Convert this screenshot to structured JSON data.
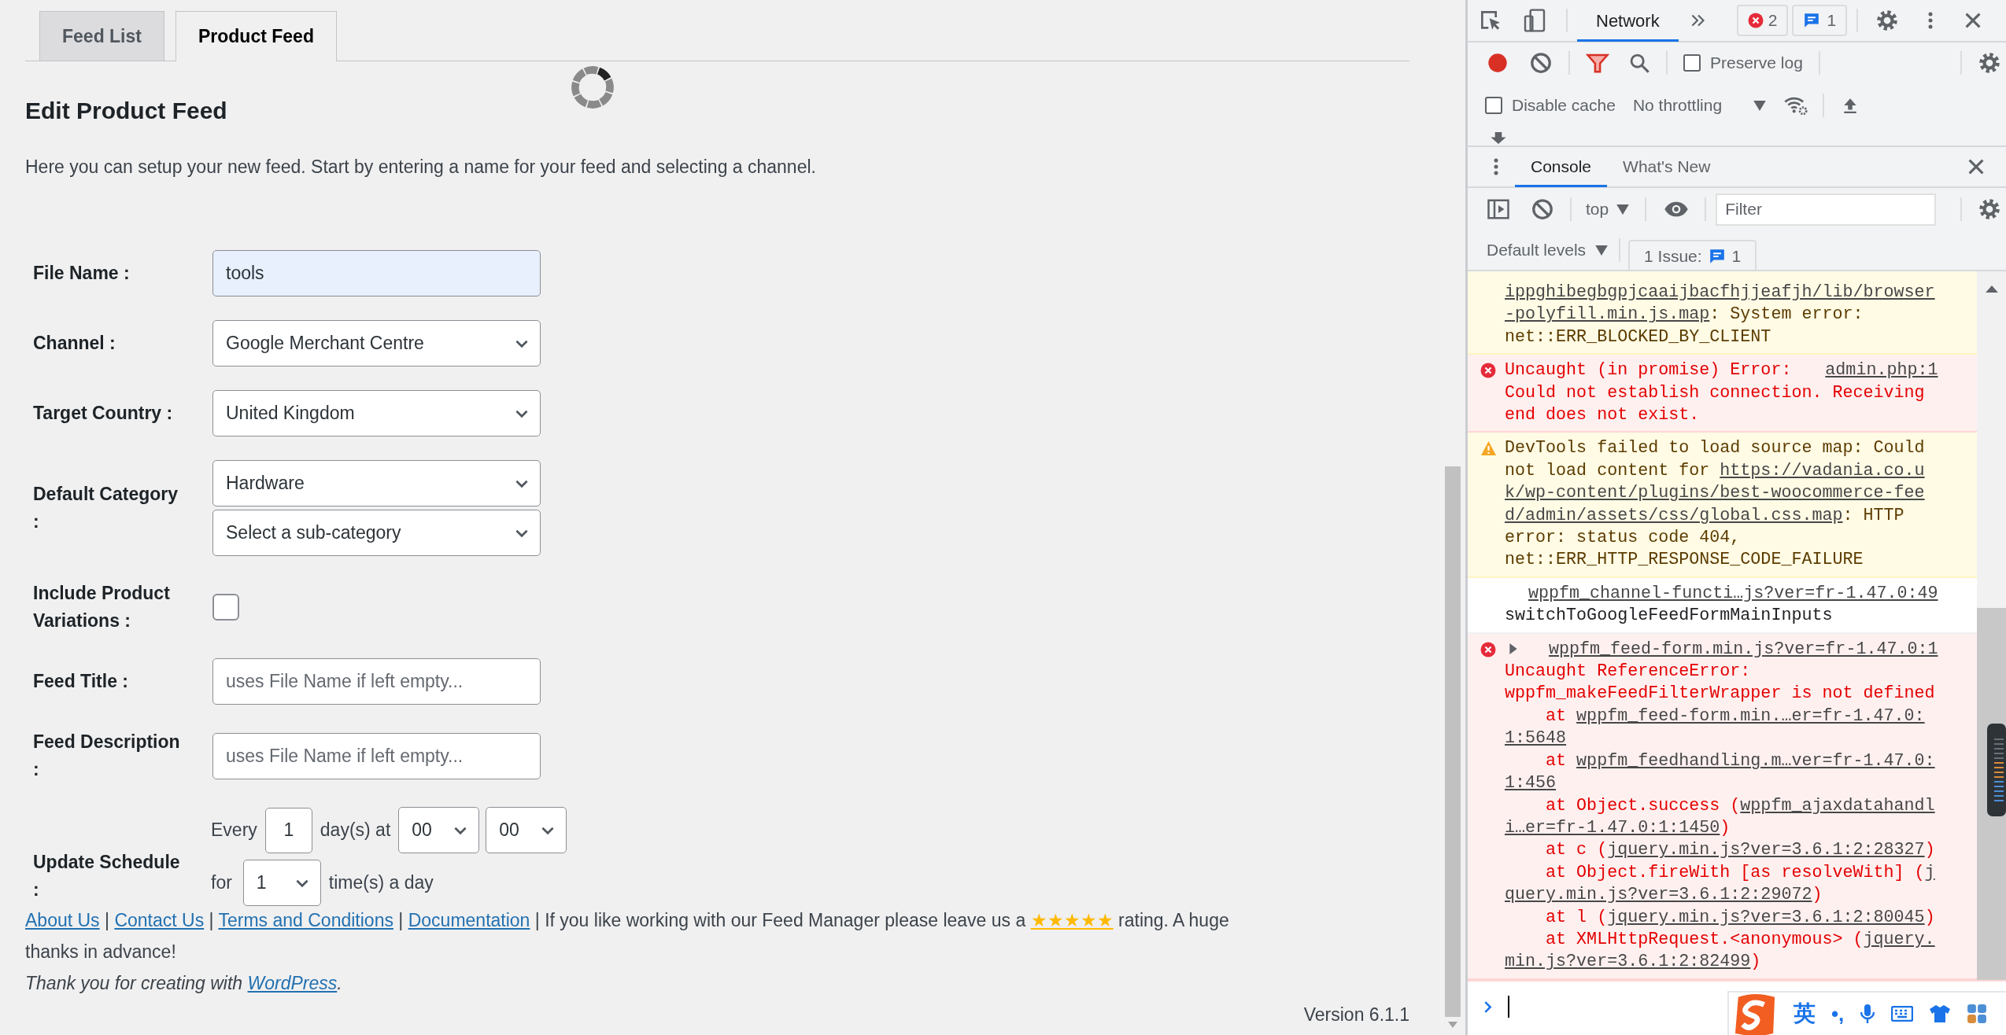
{
  "page_tabs": [
    {
      "label": "Feed List",
      "selected": false
    },
    {
      "label": "Product Feed",
      "selected": true
    }
  ],
  "loading": true,
  "heading": "Edit Product Feed",
  "intro": "Here you can setup your new feed. Start by entering a name for your feed and selecting a channel.",
  "fields": [
    {
      "kind": "text",
      "label": "File Name :",
      "value": "tools",
      "autofilled": true
    },
    {
      "kind": "select",
      "label": "Channel :",
      "values": [
        "Google Merchant Centre"
      ]
    },
    {
      "kind": "select",
      "label": "Target Country :",
      "values": [
        "United Kingdom"
      ]
    },
    {
      "kind": "select",
      "label": "Default Category :",
      "values": [
        "Hardware",
        "Select a sub-category"
      ]
    },
    {
      "kind": "checkbox",
      "label": "Include Product Variations :",
      "checked": false
    },
    {
      "kind": "text",
      "label": "Feed Title :",
      "placeholder": "uses File Name if left empty...",
      "autofilled": false
    },
    {
      "kind": "text",
      "label": "Feed Description :",
      "placeholder": "uses File Name if left empty...",
      "autofilled": false
    },
    {
      "kind": "schedule",
      "label": "Update Schedule :",
      "every_label": "Every",
      "days": "1",
      "days_label": "day(s) at",
      "hour": "00",
      "minute": "00",
      "for_label": "for",
      "times": "1",
      "times_label": "time(s) a day"
    }
  ],
  "footer": [
    {
      "kind": "link",
      "text": "About Us"
    },
    {
      "kind": "text",
      "text": " | "
    },
    {
      "kind": "link",
      "text": "Contact Us"
    },
    {
      "kind": "text",
      "text": " | "
    },
    {
      "kind": "link",
      "text": "Terms and Conditions"
    },
    {
      "kind": "text",
      "text": " | "
    },
    {
      "kind": "link",
      "text": "Documentation"
    },
    {
      "kind": "text",
      "text": " | If you like working with our Feed Manager please leave us a "
    },
    {
      "kind": "stars",
      "text": "★★★★★"
    },
    {
      "kind": "text",
      "text": " rating. A huge thanks in advance!"
    }
  ],
  "credit": [
    {
      "kind": "text",
      "text": "Thank you for creating with "
    },
    {
      "kind": "link",
      "text": "WordPress"
    },
    {
      "kind": "text",
      "text": "."
    }
  ],
  "version": "Version 6.1.1",
  "devtools": {
    "panel_tabs": [
      {
        "label": "Network",
        "selected": true
      }
    ],
    "error_count": "2",
    "message_count": "1",
    "recording": true,
    "preserve_log": {
      "label": "Preserve log",
      "checked": false
    },
    "disable_cache": {
      "label": "Disable cache",
      "checked": false
    },
    "throttling": "No throttling",
    "drawer_tabs": [
      {
        "label": "Console",
        "selected": true
      },
      {
        "label": "What's New",
        "selected": false
      }
    ],
    "context": "top",
    "filter_placeholder": "Filter",
    "levels": "Default levels",
    "issues_label": "1 Issue:",
    "issues_count": "1",
    "messages": [
      {
        "kind": "warning",
        "show_icon": false,
        "parts": [
          {
            "kind": "link",
            "text": "ippghibegbgpjcaaijbacfhjjeafjh/lib/browser"
          },
          {
            "kind": "link",
            "text": "-polyfill.min.js.map"
          },
          {
            "kind": "text",
            "text": ": System error: net::ERR_BLOCKED_BY_CLIENT"
          }
        ]
      },
      {
        "kind": "error",
        "show_icon": true,
        "parts": [
          {
            "kind": "text",
            "text": "Uncaught (in promise) Error: "
          },
          {
            "kind": "source",
            "text": "admin.php:1"
          },
          {
            "kind": "text",
            "text": "Could not establish connection. Receiving end does not exist."
          }
        ]
      },
      {
        "kind": "warning",
        "show_icon": true,
        "parts": [
          {
            "kind": "text",
            "text": "DevTools failed to load source map: Could not load content for "
          },
          {
            "kind": "link",
            "text": "https://vadania.co.u"
          },
          {
            "kind": "link",
            "text": "k/wp-content/plugins/best-woocommerce-fee"
          },
          {
            "kind": "link",
            "text": "d/admin/assets/css/global.css.map"
          },
          {
            "kind": "text",
            "text": ": HTTP error: status code 404, net::ERR_HTTP_RESPONSE_CODE_FAILURE"
          }
        ]
      },
      {
        "kind": "log",
        "parts": [
          {
            "kind": "source",
            "text": "wppfm_channel-functi…js?ver=fr-1.47.0:49"
          },
          {
            "kind": "text",
            "text": "switchToGoogleFeedFormMainInputs"
          }
        ]
      },
      {
        "kind": "error",
        "show_icon": true,
        "expanded": false,
        "parts": [
          {
            "kind": "source",
            "text": "wppfm_feed-form.min.js?ver=fr-1.47.0:1"
          },
          {
            "kind": "text",
            "text": "Uncaught ReferenceError: wppfm_makeFeedFilterWrapper is not defined\n    at "
          },
          {
            "kind": "link",
            "text": "wppfm_feed-form.min.…er=fr-1.47.0:"
          },
          {
            "kind": "link",
            "text": "1:5648"
          },
          {
            "kind": "text",
            "text": "\n    at "
          },
          {
            "kind": "link",
            "text": "wppfm_feedhandling.m…ver=fr-1.47.0:"
          },
          {
            "kind": "link",
            "text": "1:456"
          },
          {
            "kind": "text",
            "text": "\n    at Object.success ("
          },
          {
            "kind": "link",
            "text": "wppfm_ajaxdatahandl"
          },
          {
            "kind": "link",
            "text": "i…er=fr-1.47.0:1:1450"
          },
          {
            "kind": "text",
            "text": ")\n    at c ("
          },
          {
            "kind": "link",
            "text": "jquery.min.js?ver=3.6.1:2:28327"
          },
          {
            "kind": "text",
            "text": ")\n    at Object.fireWith [as resolveWith] ("
          },
          {
            "kind": "link",
            "text": "j"
          },
          {
            "kind": "link",
            "text": "query.min.js?ver=3.6.1:2:29072"
          },
          {
            "kind": "text",
            "text": ")\n    at l ("
          },
          {
            "kind": "link",
            "text": "jquery.min.js?ver=3.6.1:2:80045"
          },
          {
            "kind": "text",
            "text": ")\n    at XMLHttpRequest.<anonymous> ("
          },
          {
            "kind": "link",
            "text": "jquery."
          },
          {
            "kind": "link",
            "text": "min.js?ver=3.6.1:2:82499"
          },
          {
            "kind": "text",
            "text": ")"
          }
        ]
      }
    ]
  },
  "ime": {
    "mode": "英",
    "punctuation": "•,"
  }
}
